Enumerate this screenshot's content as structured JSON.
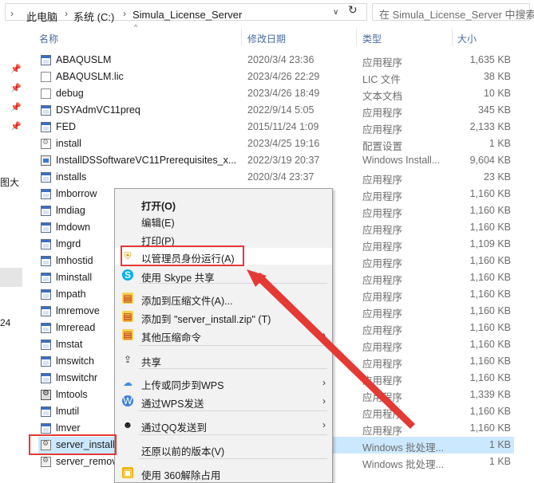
{
  "address": {
    "crumbs": [
      "此电脑",
      "系统 (C:)",
      "Simula_License_Server"
    ],
    "separator": "›",
    "dropdown_glyph": "∨",
    "refresh_glyph": "↻",
    "search_placeholder": "在 Simula_License_Server 中搜索"
  },
  "nav": {
    "fragments": [
      "图大",
      "24"
    ]
  },
  "columns": {
    "name": "名称",
    "date": "修改日期",
    "type": "类型",
    "size": "大小",
    "sort_glyph": "^"
  },
  "files": [
    {
      "name": "ABAQUSLM",
      "date": "2020/3/4 23:36",
      "type": "应用程序",
      "size": "1,635 KB",
      "icon": "app"
    },
    {
      "name": "ABAQUSLM.lic",
      "date": "2023/4/26 22:29",
      "type": "LIC 文件",
      "size": "38 KB",
      "icon": "doc"
    },
    {
      "name": "debug",
      "date": "2023/4/26 18:49",
      "type": "文本文档",
      "size": "10 KB",
      "icon": "doc"
    },
    {
      "name": "DSYAdmVC11preq",
      "date": "2022/9/14 5:05",
      "type": "应用程序",
      "size": "345 KB",
      "icon": "app"
    },
    {
      "name": "FED",
      "date": "2015/11/24 1:09",
      "type": "应用程序",
      "size": "2,133 KB",
      "icon": "app"
    },
    {
      "name": "install",
      "date": "2023/4/25 19:16",
      "type": "配置设置",
      "size": "1 KB",
      "icon": "cfg"
    },
    {
      "name": "InstallDSSoftwareVC11Prerequisites_x...",
      "date": "2022/3/19 20:37",
      "type": "Windows Install...",
      "size": "9,604 KB",
      "icon": "msi"
    },
    {
      "name": "installs",
      "date": "2020/3/4 23:37",
      "type": "应用程序",
      "size": "23 KB",
      "icon": "app"
    },
    {
      "name": "lmborrow",
      "date": "",
      "type": "应用程序",
      "size": "1,160 KB",
      "icon": "app"
    },
    {
      "name": "lmdiag",
      "date": "",
      "type": "应用程序",
      "size": "1,160 KB",
      "icon": "app"
    },
    {
      "name": "lmdown",
      "date": "",
      "type": "应用程序",
      "size": "1,160 KB",
      "icon": "app"
    },
    {
      "name": "lmgrd",
      "date": "",
      "type": "应用程序",
      "size": "1,109 KB",
      "icon": "app"
    },
    {
      "name": "lmhostid",
      "date": "",
      "type": "应用程序",
      "size": "1,160 KB",
      "icon": "app"
    },
    {
      "name": "lminstall",
      "date": "",
      "type": "应用程序",
      "size": "1,160 KB",
      "icon": "app"
    },
    {
      "name": "lmpath",
      "date": "",
      "type": "应用程序",
      "size": "1,160 KB",
      "icon": "app"
    },
    {
      "name": "lmremove",
      "date": "",
      "type": "应用程序",
      "size": "1,160 KB",
      "icon": "app"
    },
    {
      "name": "lmreread",
      "date": "",
      "type": "应用程序",
      "size": "1,160 KB",
      "icon": "app"
    },
    {
      "name": "lmstat",
      "date": "",
      "type": "应用程序",
      "size": "1,160 KB",
      "icon": "app"
    },
    {
      "name": "lmswitch",
      "date": "",
      "type": "应用程序",
      "size": "1,160 KB",
      "icon": "app"
    },
    {
      "name": "lmswitchr",
      "date": "",
      "type": "应用程序",
      "size": "1,160 KB",
      "icon": "app"
    },
    {
      "name": "lmtools",
      "date": "",
      "type": "应用程序",
      "size": "1,339 KB",
      "icon": "tools"
    },
    {
      "name": "lmutil",
      "date": "",
      "type": "应用程序",
      "size": "1,160 KB",
      "icon": "app"
    },
    {
      "name": "lmver",
      "date": "",
      "type": "应用程序",
      "size": "1,160 KB",
      "icon": "app"
    },
    {
      "name": "server_install",
      "date": "",
      "type": "Windows 批处理...",
      "size": "1 KB",
      "icon": "bat"
    },
    {
      "name": "server_remove",
      "date": "",
      "type": "Windows 批处理...",
      "size": "1 KB",
      "icon": "bat"
    }
  ],
  "menu": {
    "items": [
      {
        "label": "打开(O)",
        "bold": true,
        "icon": ""
      },
      {
        "label": "编辑(E)",
        "icon": ""
      },
      {
        "label": "打印(P)",
        "icon": ""
      },
      {
        "label": "以管理员身份运行(A)",
        "icon": "shield-icon",
        "glyph": "⛨"
      },
      {
        "label": "使用 Skype 共享",
        "icon": "skype-icon",
        "glyph": "S"
      },
      {
        "label": "添加到压缩文件(A)...",
        "icon": "archive-icon",
        "glyph": "▤"
      },
      {
        "label": "添加到 \"server_install.zip\" (T)",
        "icon": "archive-icon",
        "glyph": "▤"
      },
      {
        "label": "其他压缩命令",
        "icon": "archive-icon",
        "glyph": "▤",
        "submenu": true
      },
      {
        "label": "共享",
        "icon": "share-icon",
        "glyph": "⇪"
      },
      {
        "label": "上传或同步到WPS",
        "icon": "cloud-icon",
        "glyph": "☁",
        "submenu": true
      },
      {
        "label": "通过WPS发送",
        "icon": "wps-icon",
        "glyph": "W",
        "submenu": true
      },
      {
        "label": "通过QQ发送到",
        "icon": "qq-icon",
        "glyph": "☻",
        "submenu": true
      },
      {
        "label": "还原以前的版本(V)",
        "icon": ""
      },
      {
        "label": "使用 360解除占用",
        "icon": "360-icon",
        "glyph": "▣"
      }
    ],
    "submenu_glyph": "›"
  },
  "colors": {
    "accent_red": "#e53935",
    "selection": "#cce8ff",
    "header_text": "#4a6aa0"
  }
}
